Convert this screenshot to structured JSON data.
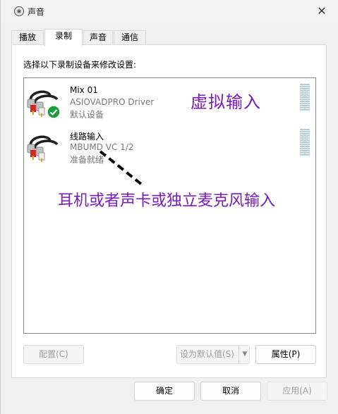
{
  "window": {
    "title": "声音",
    "close_glyph": "✕"
  },
  "tabs": [
    {
      "label": "播放"
    },
    {
      "label": "录制"
    },
    {
      "label": "声音"
    },
    {
      "label": "通信"
    }
  ],
  "panel": {
    "instruction": "选择以下录制设备来修改设置:",
    "devices": [
      {
        "name": "Mix 01",
        "driver": "ASIOVADPRO Driver",
        "status": "默认设备",
        "is_default": true
      },
      {
        "name": "线路输入",
        "driver": "MBUMD VC 1/2",
        "status": "准备就绪",
        "is_default": false
      }
    ],
    "buttons": {
      "configure": "配置(C)",
      "set_default": "设为默认值(S)",
      "properties": "属性(P)"
    }
  },
  "annotations": {
    "virtual_input": "虚拟输入",
    "hardware_input": "耳机或者声卡或独立麦克风输入",
    "color": "#7a1bbf"
  },
  "footer": {
    "ok": "确定",
    "cancel": "取消",
    "apply": "应用(A)"
  },
  "colors": {
    "accent_check": "#1a9e3a",
    "meter": "#b6cfd6"
  }
}
